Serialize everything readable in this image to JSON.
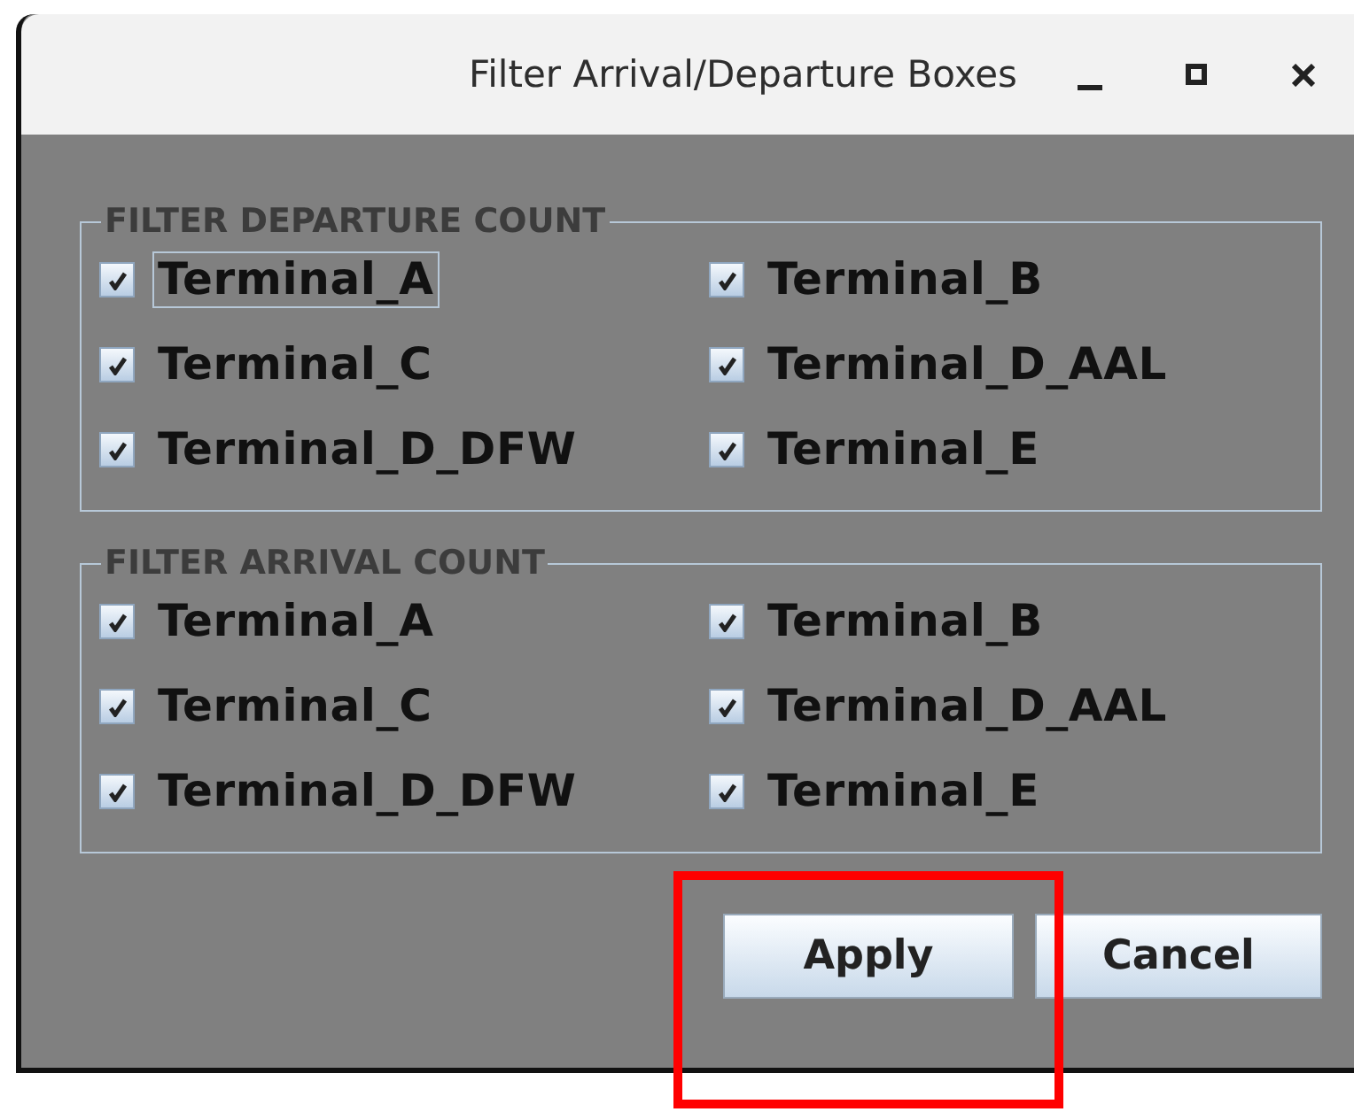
{
  "window": {
    "title": "Filter Arrival/Departure Boxes"
  },
  "groups": [
    {
      "title": "FILTER DEPARTURE COUNT",
      "items": [
        {
          "label": "Terminal_A",
          "checked": true,
          "focused": true
        },
        {
          "label": "Terminal_B",
          "checked": true,
          "focused": false
        },
        {
          "label": "Terminal_C",
          "checked": true,
          "focused": false
        },
        {
          "label": "Terminal_D_AAL",
          "checked": true,
          "focused": false
        },
        {
          "label": "Terminal_D_DFW",
          "checked": true,
          "focused": false
        },
        {
          "label": "Terminal_E",
          "checked": true,
          "focused": false
        }
      ]
    },
    {
      "title": "FILTER ARRIVAL COUNT",
      "items": [
        {
          "label": "Terminal_A",
          "checked": true,
          "focused": false
        },
        {
          "label": "Terminal_B",
          "checked": true,
          "focused": false
        },
        {
          "label": "Terminal_C",
          "checked": true,
          "focused": false
        },
        {
          "label": "Terminal_D_AAL",
          "checked": true,
          "focused": false
        },
        {
          "label": "Terminal_D_DFW",
          "checked": true,
          "focused": false
        },
        {
          "label": "Terminal_E",
          "checked": true,
          "focused": false
        }
      ]
    }
  ],
  "buttons": [
    {
      "label": "Apply"
    },
    {
      "label": "Cancel"
    }
  ],
  "annotations": [
    {
      "kind": "highlight-box"
    }
  ]
}
